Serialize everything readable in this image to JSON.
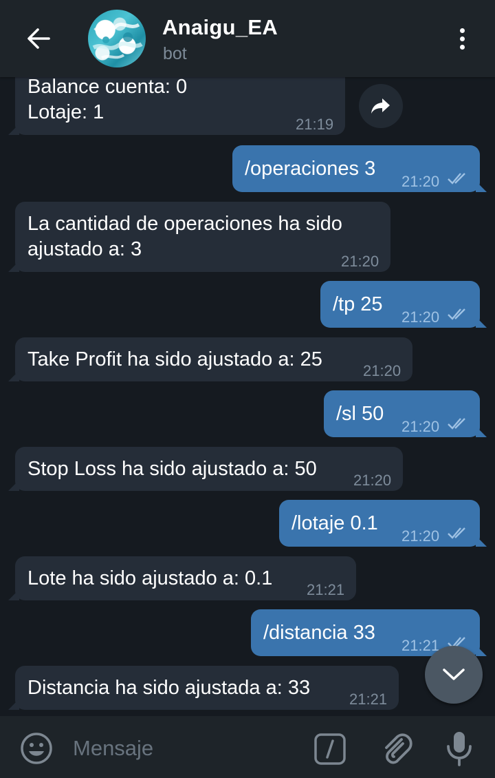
{
  "header": {
    "title": "Anaigu_EA",
    "subtitle": "bot"
  },
  "messages": [
    {
      "id": "m1",
      "direction": "in",
      "lines": [
        "Balance cuenta: 0",
        "Lotaje: 1"
      ],
      "time": "21:19"
    },
    {
      "id": "m2",
      "direction": "out",
      "text": "/operaciones 3",
      "time": "21:20",
      "read": true
    },
    {
      "id": "m3",
      "direction": "in",
      "lines": [
        "La cantidad de operaciones ha sido",
        "ajustado a: 3"
      ],
      "time": "21:20"
    },
    {
      "id": "m4",
      "direction": "out",
      "text": "/tp 25",
      "time": "21:20",
      "read": true
    },
    {
      "id": "m5",
      "direction": "in",
      "text": "Take Profit ha sido ajustado a: 25",
      "time": "21:20"
    },
    {
      "id": "m6",
      "direction": "out",
      "text": "/sl 50",
      "time": "21:20",
      "read": true
    },
    {
      "id": "m7",
      "direction": "in",
      "text": "Stop Loss ha sido ajustado a: 50",
      "time": "21:20"
    },
    {
      "id": "m8",
      "direction": "out",
      "text": "/lotaje 0.1",
      "time": "21:20",
      "read": true
    },
    {
      "id": "m9",
      "direction": "in",
      "text": "Lote ha sido ajustado a: 0.1",
      "time": "21:21"
    },
    {
      "id": "m10",
      "direction": "out",
      "text": "/distancia 33",
      "time": "21:21",
      "read": true
    },
    {
      "id": "m11",
      "direction": "in",
      "text": "Distancia ha sido ajustada a: 33",
      "time": "21:21"
    }
  ],
  "input": {
    "placeholder": "Mensaje"
  },
  "icons": {
    "back": "arrow-left",
    "menu": "more-vertical",
    "share": "share-arrow",
    "scroll": "chevron-down",
    "emoji": "smiley",
    "bot_commands": "slash-command",
    "attach": "paperclip",
    "mic": "microphone"
  },
  "colors": {
    "background": "#151a20",
    "header": "#1e2429",
    "incoming_bubble": "#252d38",
    "outgoing_bubble": "#3a74ad"
  }
}
